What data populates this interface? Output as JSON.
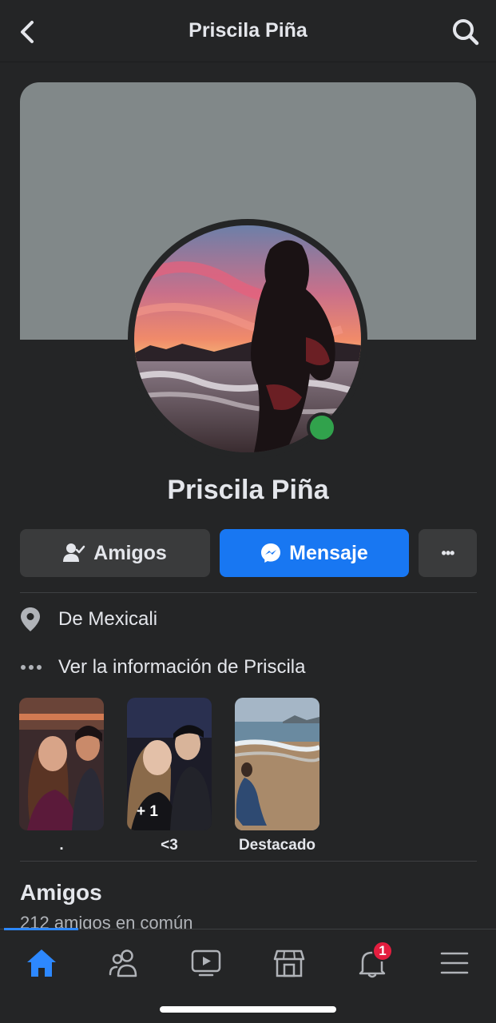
{
  "header": {
    "title": "Priscila Piña",
    "back_icon": "chevron-left-icon",
    "search_icon": "search-icon"
  },
  "profile": {
    "name": "Priscila Piña",
    "online": true
  },
  "actions": {
    "friends_label": "Amigos",
    "message_label": "Mensaje",
    "more_label": "•••"
  },
  "info": {
    "location": "De Mexicali",
    "see_info": "Ver la información de Priscila"
  },
  "highlights": [
    {
      "label": ".",
      "count": ""
    },
    {
      "label": "<3",
      "count": "+ 1"
    },
    {
      "label": "Destacado",
      "count": ""
    }
  ],
  "friends_section": {
    "title": "Amigos",
    "subtitle": "212 amigos en común"
  },
  "tabbar": {
    "items": [
      "home",
      "friends",
      "watch",
      "marketplace",
      "notifications",
      "menu"
    ],
    "notifications_badge": "1",
    "active": "home"
  },
  "colors": {
    "accent": "#1877f2",
    "online": "#31a24c",
    "badge": "#e41e3f",
    "background": "#242526"
  }
}
